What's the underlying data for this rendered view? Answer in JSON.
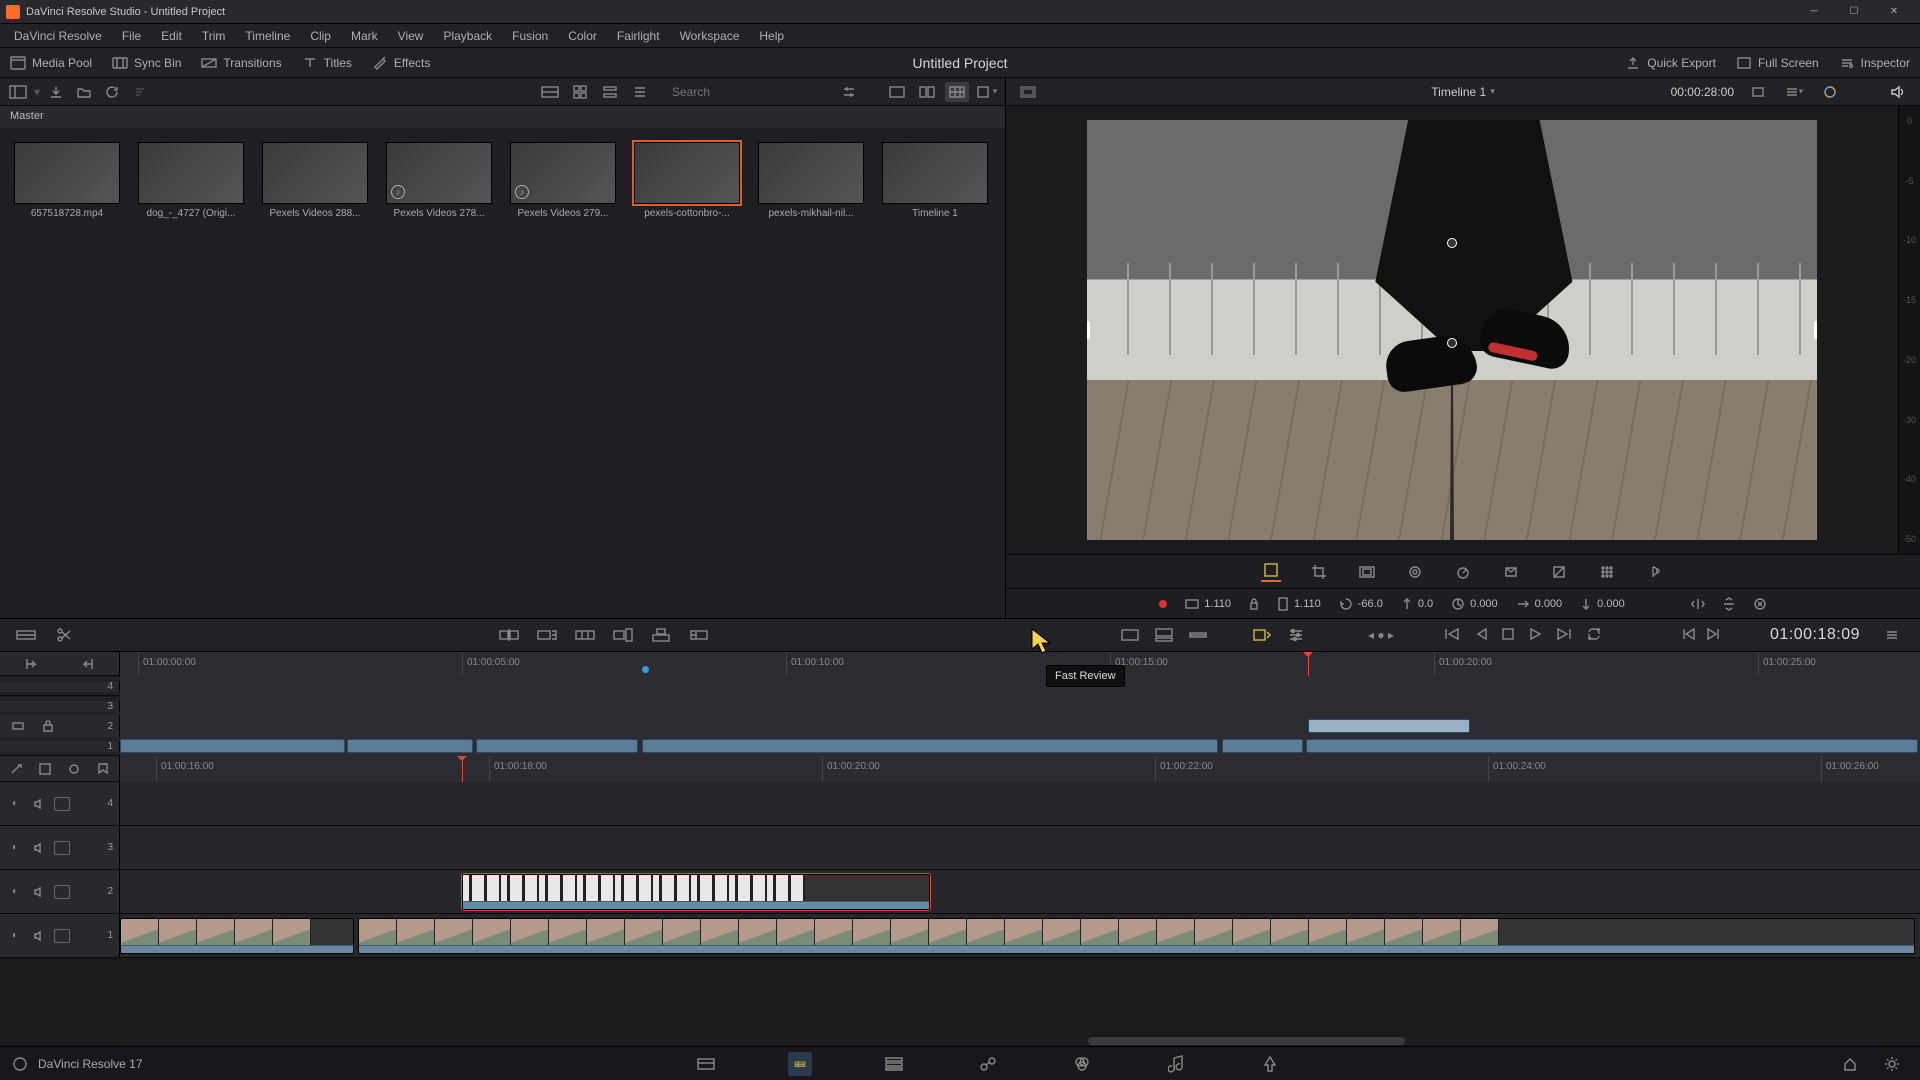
{
  "window": {
    "title": "DaVinci Resolve Studio - Untitled Project"
  },
  "menus": [
    "DaVinci Resolve",
    "File",
    "Edit",
    "Trim",
    "Timeline",
    "Clip",
    "Mark",
    "View",
    "Playback",
    "Fusion",
    "Color",
    "Fairlight",
    "Workspace",
    "Help"
  ],
  "toolbar": {
    "media_pool": "Media Pool",
    "sync_bin": "Sync Bin",
    "transitions": "Transitions",
    "titles": "Titles",
    "effects": "Effects",
    "project_title": "Untitled Project",
    "quick_export": "Quick Export",
    "full_screen": "Full Screen",
    "inspector": "Inspector"
  },
  "media": {
    "breadcrumb": "Master",
    "search_placeholder": "Search",
    "clips": [
      {
        "label": "657518728.mp4",
        "audio": false,
        "selected": false
      },
      {
        "label": "dog_-_4727 (Origi...",
        "audio": false,
        "selected": false
      },
      {
        "label": "Pexels Videos 288...",
        "audio": false,
        "selected": false
      },
      {
        "label": "Pexels Videos 278...",
        "audio": true,
        "selected": false
      },
      {
        "label": "Pexels Videos 279...",
        "audio": true,
        "selected": false
      },
      {
        "label": "pexels-cottonbro-...",
        "audio": false,
        "selected": true
      },
      {
        "label": "pexels-mikhail-nil...",
        "audio": false,
        "selected": false
      },
      {
        "label": "Timeline 1",
        "audio": false,
        "selected": false
      }
    ]
  },
  "viewer": {
    "timeline_name": "Timeline 1",
    "duration_tc": "00:00:28:00",
    "db_marks": [
      "0",
      "-5",
      "-10",
      "-15",
      "-20",
      "-30",
      "-40",
      "-50"
    ],
    "tooltip": "Fast Review",
    "params": {
      "zoom_a": "1.110",
      "zoom_b": "1.110",
      "rot": "-66.0",
      "pitch": "0.0",
      "yaw": "0.000",
      "cx": "0.000",
      "cy": "0.000"
    },
    "current_tc": "01:00:18:09"
  },
  "upper_timeline": {
    "ticks": [
      "01:00:00:00",
      "01:00:05:00",
      "01:00:10:00",
      "01:00:15:00",
      "01:00:20:00",
      "01:00:25:00"
    ],
    "tracks": [
      "4",
      "3",
      "2",
      "1"
    ]
  },
  "lower_timeline": {
    "ticks": [
      "01:00:16:00",
      "01:00:18:00",
      "01:00:20:00",
      "01:00:22:00",
      "01:00:24:00",
      "01:00:26:00"
    ],
    "tracks": [
      "4",
      "3",
      "2",
      "1"
    ]
  },
  "statusbar": {
    "version": "DaVinci Resolve 17"
  }
}
